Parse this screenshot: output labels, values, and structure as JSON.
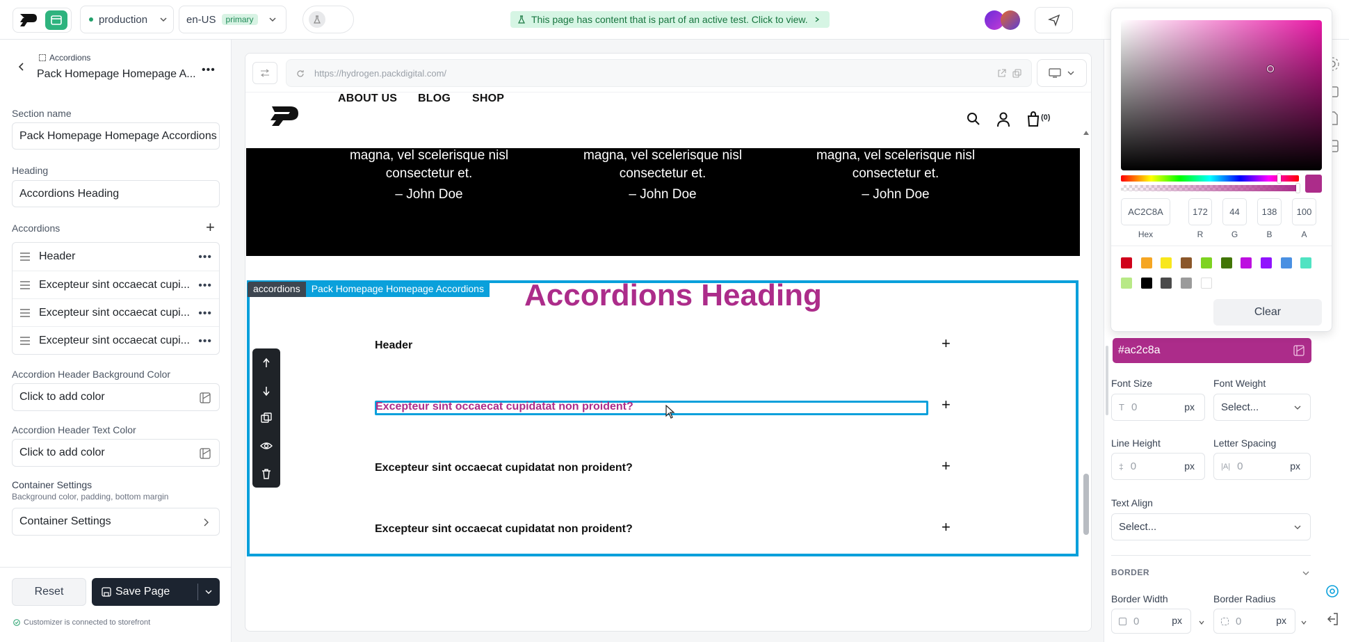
{
  "topbar": {
    "env_label": "production",
    "locale_label": "en-US",
    "locale_tag": "primary",
    "banner_text": "This page has content that is part of an active test. Click to view."
  },
  "left_panel": {
    "breadcrumb": "Accordions",
    "title": "Pack Homepage Homepage A...",
    "section_name_label": "Section name",
    "section_name_value": "Pack Homepage Homepage Accordions",
    "heading_label": "Heading",
    "heading_value": "Accordions Heading",
    "accordions_label": "Accordions",
    "accordion_items": [
      {
        "label": "Header"
      },
      {
        "label": "Excepteur sint occaecat cupi..."
      },
      {
        "label": "Excepteur sint occaecat cupi..."
      },
      {
        "label": "Excepteur sint occaecat cupi..."
      }
    ],
    "header_bg_label": "Accordion Header Background Color",
    "header_bg_value": "Click to add color",
    "header_text_label": "Accordion Header Text Color",
    "header_text_value": "Click to add color",
    "container_title": "Container Settings",
    "container_sub": "Background color, padding, bottom margin",
    "container_button": "Container Settings",
    "reset_label": "Reset",
    "save_label": "Save Page",
    "status_text": "Customizer is connected to storefront"
  },
  "preview": {
    "url": "https://hydrogen.packdigital.com/",
    "nav": [
      {
        "label": "ABOUT US"
      },
      {
        "label": "BLOG"
      },
      {
        "label": "SHOP"
      }
    ],
    "cart_count": "(0)",
    "testimonials": [
      {
        "quote": "magna, vel scelerisque nisl consectetur et.",
        "author": "– John Doe"
      },
      {
        "quote": "magna, vel scelerisque nisl consectetur et.",
        "author": "– John Doe"
      },
      {
        "quote": "magna, vel scelerisque nisl consectetur et.",
        "author": "– John Doe"
      }
    ],
    "section_tag_type": "accordions",
    "section_tag_name": "Pack Homepage Homepage Accordions",
    "accordion_heading": "Accordions Heading",
    "accordion_rows": [
      {
        "label": "Header"
      },
      {
        "label": "Excepteur sint occaecat cupidatat non proident?"
      },
      {
        "label": "Excepteur sint occaecat cupidatat non proident?"
      },
      {
        "label": "Excepteur sint occaecat cupidatat non proident?"
      }
    ]
  },
  "color_picker": {
    "hex": "AC2C8A",
    "r": "172",
    "g": "44",
    "b": "138",
    "a": "100",
    "labels": {
      "hex": "Hex",
      "r": "R",
      "g": "G",
      "b": "B",
      "a": "A"
    },
    "presets": [
      "#d0021b",
      "#f5a623",
      "#f8e71c",
      "#8b572a",
      "#7ed321",
      "#417505",
      "#bd10e0",
      "#9013fe",
      "#4a90e2",
      "#50e3c2",
      "#b8e986",
      "#000000",
      "#4a4a4a",
      "#9b9b9b",
      "#ffffff"
    ],
    "clear_label": "Clear",
    "accent": "#ac2c8a"
  },
  "right_panel": {
    "color_value": "#ac2c8a",
    "font_size_label": "Font Size",
    "font_size_value": "0",
    "font_weight_label": "Font Weight",
    "font_weight_value": "Select...",
    "line_height_label": "Line Height",
    "line_height_value": "0",
    "letter_spacing_label": "Letter Spacing",
    "letter_spacing_value": "0",
    "text_align_label": "Text Align",
    "text_align_value": "Select...",
    "border_section": "BORDER",
    "border_width_label": "Border Width",
    "border_width_value": "0",
    "border_radius_label": "Border Radius",
    "border_radius_value": "0",
    "unit": "px"
  }
}
